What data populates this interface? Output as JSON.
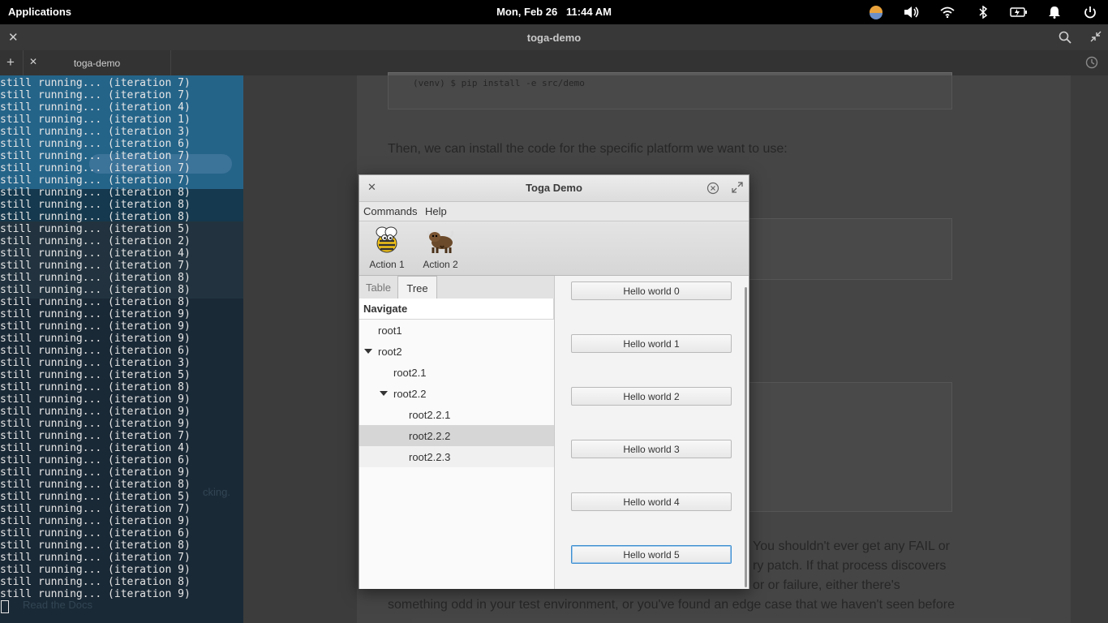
{
  "top_panel": {
    "applications_label": "Applications",
    "clock": "Mon, Feb 26   11:44 AM",
    "tray_icons": [
      "weather-icon",
      "volume-icon",
      "wifi-icon",
      "bluetooth-icon",
      "battery-icon",
      "notifications-icon",
      "power-icon"
    ]
  },
  "terminal": {
    "window_title": "toga-demo",
    "tab_label": "toga-demo",
    "lines": [
      "still running... (iteration 7)",
      "still running... (iteration 7)",
      "still running... (iteration 4)",
      "still running... (iteration 1)",
      "still running... (iteration 3)",
      "still running... (iteration 6)",
      "still running... (iteration 7)",
      "still running... (iteration 7)",
      "still running... (iteration 7)",
      "still running... (iteration 8)",
      "still running... (iteration 8)",
      "still running... (iteration 8)",
      "still running... (iteration 5)",
      "still running... (iteration 2)",
      "still running... (iteration 4)",
      "still running... (iteration 7)",
      "still running... (iteration 8)",
      "still running... (iteration 8)",
      "still running... (iteration 8)",
      "still running... (iteration 9)",
      "still running... (iteration 9)",
      "still running... (iteration 9)",
      "still running... (iteration 6)",
      "still running... (iteration 3)",
      "still running... (iteration 5)",
      "still running... (iteration 8)",
      "still running... (iteration 9)",
      "still running... (iteration 9)",
      "still running... (iteration 9)",
      "still running... (iteration 7)",
      "still running... (iteration 4)",
      "still running... (iteration 6)",
      "still running... (iteration 9)",
      "still running... (iteration 8)",
      "still running... (iteration 5)",
      "still running... (iteration 7)",
      "still running... (iteration 9)",
      "still running... (iteration 6)",
      "still running... (iteration 8)",
      "still running... (iteration 7)",
      "still running... (iteration 9)",
      "still running... (iteration 8)",
      "still running... (iteration 9)"
    ]
  },
  "background_doc": {
    "code_line": "(venv) $ pip install -e src/demo",
    "paragraph1": "Then, we can install the code for the specific platform we want to use:",
    "paragraph2a": "You shouldn't ever get any FAIL or",
    "paragraph2b": "ry patch. If that process discovers",
    "paragraph2c": "or or failure, either there's",
    "paragraph2d": "something odd in your test environment, or you've found an edge case that we haven't seen before",
    "sidebar_text1": "cking.",
    "sidebar_text2": "Read the Docs"
  },
  "dialog": {
    "title": "Toga Demo",
    "menu": [
      "Commands",
      "Help"
    ],
    "actions": [
      {
        "label": "Action 1",
        "icon": "bee-icon"
      },
      {
        "label": "Action 2",
        "icon": "yak-icon"
      }
    ],
    "tabs": [
      "Table",
      "Tree"
    ],
    "active_tab": "Tree",
    "tree_header": "Navigate",
    "tree_rows": [
      "root1",
      "root2",
      "root2.1",
      "root2.2",
      "root2.2.1",
      "root2.2.2",
      "root2.2.3"
    ],
    "selected_row": "root2.2.2",
    "buttons": [
      "Hello world 0",
      "Hello world 1",
      "Hello world 2",
      "Hello world 3",
      "Hello world 4",
      "Hello world 5"
    ],
    "focused_button": "Hello world 5"
  },
  "colors": {
    "panel": "#000000",
    "terminal_bg": "#2b2b2b",
    "focus_accent": "#3d8fd1"
  }
}
